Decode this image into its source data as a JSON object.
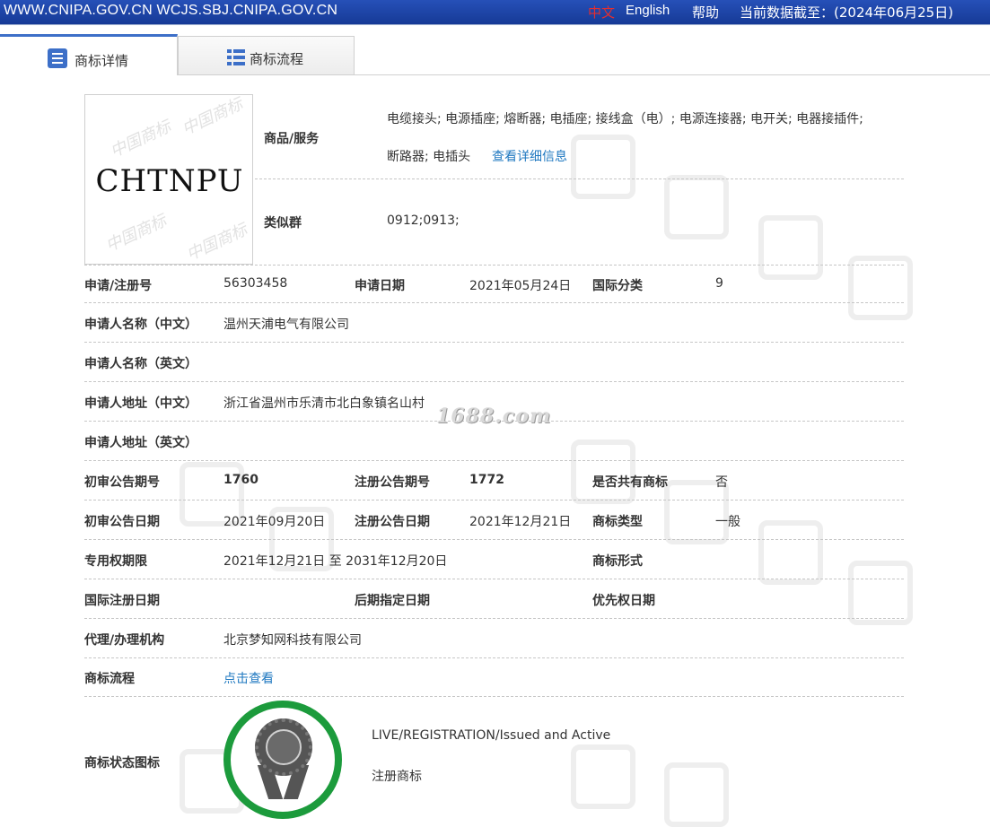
{
  "topbar": {
    "site": "WWW.CNIPA.GOV.CN WCJS.SBJ.CNIPA.GOV.CN",
    "lang_cn": "中文",
    "lang_en": "English",
    "help": "帮助",
    "data_date": "当前数据截至：(2024年06月25日)"
  },
  "tabs": [
    {
      "label": "商标详情",
      "icon": "list-detail-icon",
      "active": true
    },
    {
      "label": "商标流程",
      "icon": "table-list-icon",
      "active": false
    }
  ],
  "logo": {
    "text": "CHTNPU",
    "watermark": "中国商标"
  },
  "detail": {
    "goods_label": "商品/服务",
    "goods_line1": "电缆接头; 电源插座; 熔断器; 电插座; 接线盒（电）; 电源连接器; 电开关; 电器接插件;",
    "goods_line2": "断路器; 电插头",
    "goods_more": "查看详细信息",
    "group_label": "类似群",
    "group_value": "0912;0913;",
    "reg_no_label": "申请/注册号",
    "reg_no": "56303458",
    "apply_date_label": "申请日期",
    "apply_date": "2021年05月24日",
    "intl_class_label": "国际分类",
    "intl_class": "9",
    "applicant_cn_label": "申请人名称（中文）",
    "applicant_cn": "温州天浦电气有限公司",
    "applicant_en_label": "申请人名称（英文）",
    "applicant_en": "",
    "address_cn_label": "申请人地址（中文）",
    "address_cn": "浙江省温州市乐清市北白象镇名山村",
    "address_en_label": "申请人地址（英文）",
    "address_en": "",
    "prelim_no_label": "初审公告期号",
    "prelim_no": "1760",
    "reg_pub_no_label": "注册公告期号",
    "reg_pub_no": "1772",
    "shared_label": "是否共有商标",
    "shared": "否",
    "prelim_date_label": "初审公告日期",
    "prelim_date": "2021年09月20日",
    "reg_pub_date_label": "注册公告日期",
    "reg_pub_date": "2021年12月21日",
    "type_label": "商标类型",
    "type": "一般",
    "term_label": "专用权期限",
    "term": "2021年12月21日 至 2031年12月20日",
    "form_label": "商标形式",
    "form": "",
    "intl_reg_date_label": "国际注册日期",
    "later_designation_label": "后期指定日期",
    "priority_date_label": "优先权日期",
    "agent_label": "代理/办理机构",
    "agent": "北京梦知网科技有限公司",
    "flow_label": "商标流程",
    "flow_link": "点击查看",
    "status_label": "商标状态图标",
    "status_en": "LIVE/REGISTRATION/Issued and Active",
    "status_cn": "注册商标"
  },
  "watermarks": {
    "site": "1688.com",
    "bg_chars": [
      "中",
      "国",
      "商",
      "标"
    ]
  },
  "colors": {
    "topbar": "#1a3fa0",
    "accent": "#3d6fc8",
    "link": "#1f78c0",
    "badge_ring": "#1c9b3c",
    "lang_active": "#e52e2e"
  }
}
